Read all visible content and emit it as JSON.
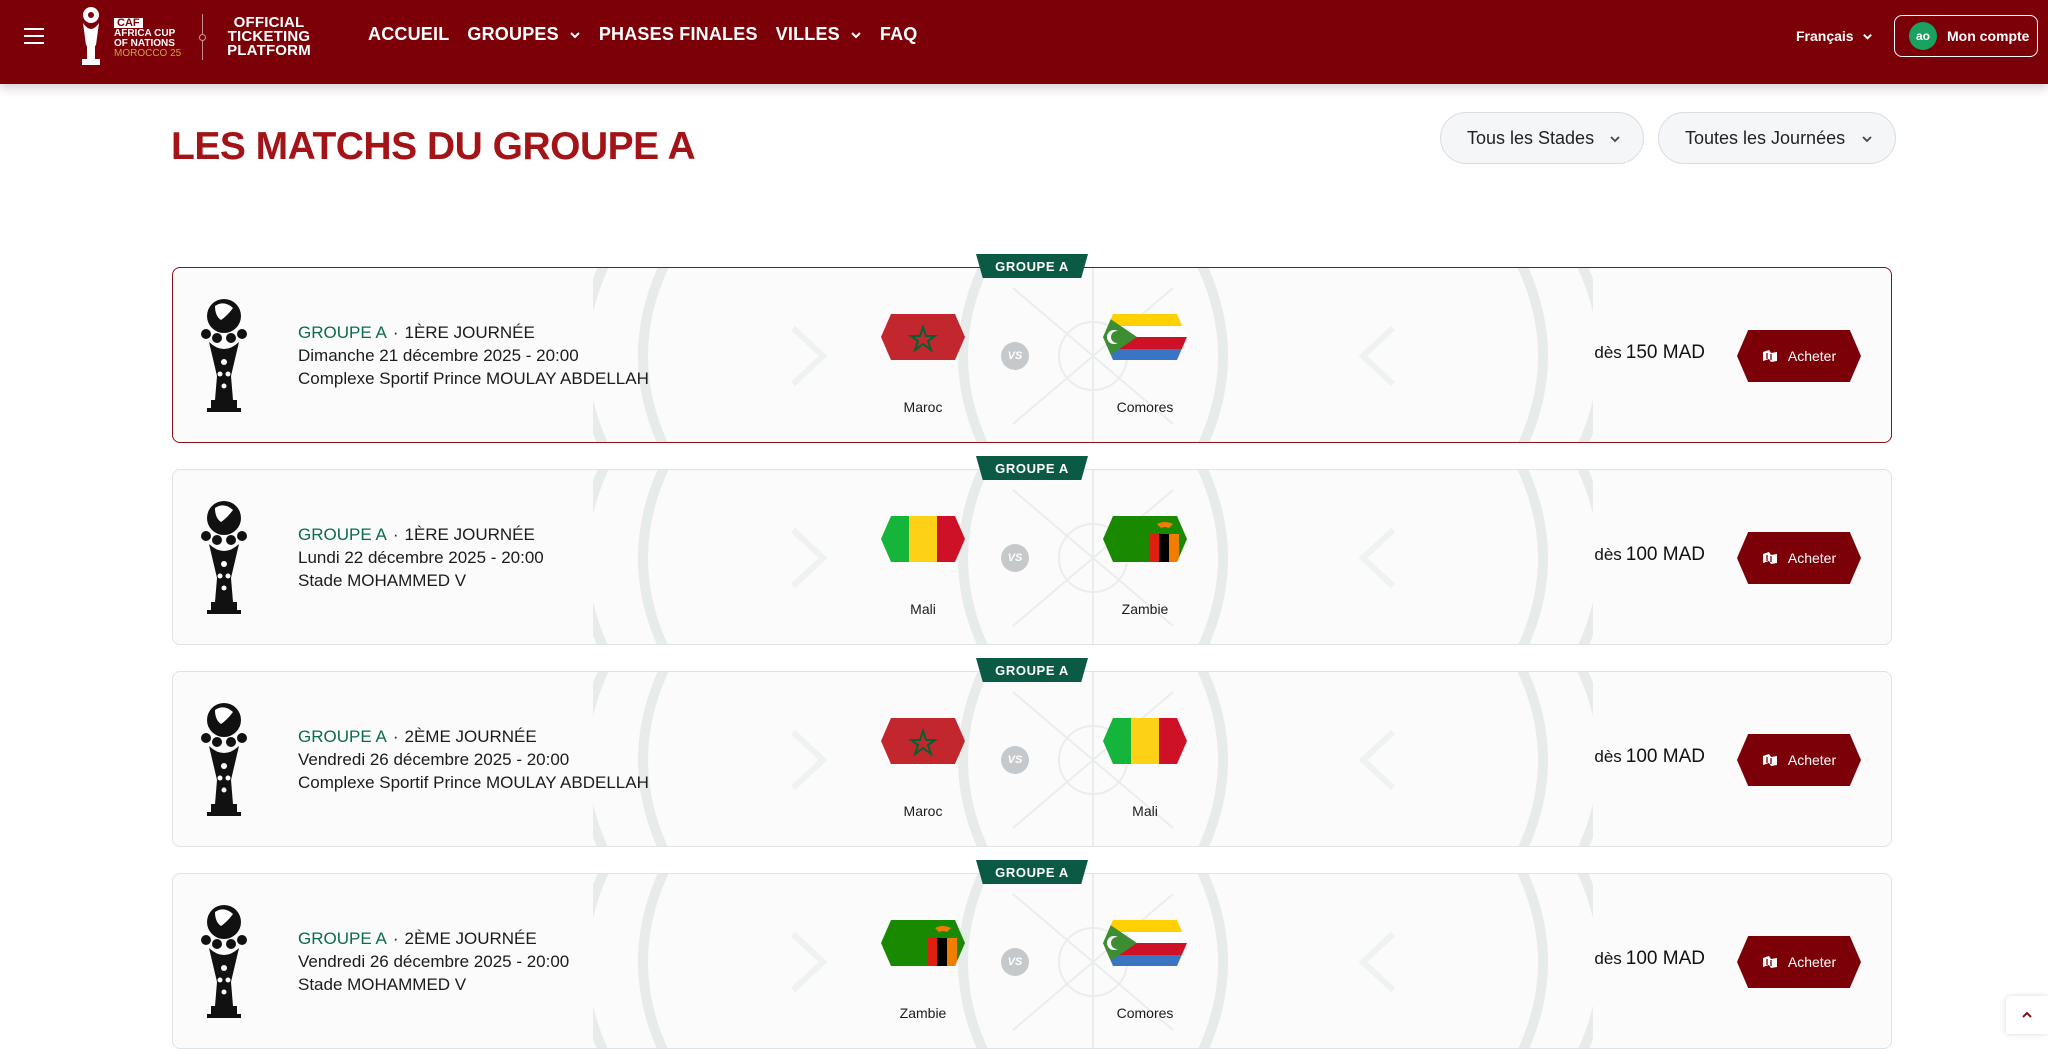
{
  "header": {
    "logo": {
      "caf": "CAF",
      "line1": "AFRICA CUP",
      "line2": "OF NATIONS",
      "line3": "MOROCCO 25"
    },
    "platform": {
      "line1": "OFFICIAL",
      "line2": "TICKETING",
      "line3": "PLATFORM"
    },
    "nav": [
      {
        "label": "ACCUEIL",
        "dropdown": false
      },
      {
        "label": "GROUPES",
        "dropdown": true
      },
      {
        "label": "PHASES FINALES",
        "dropdown": false
      },
      {
        "label": "VILLES",
        "dropdown": true
      },
      {
        "label": "FAQ",
        "dropdown": false
      }
    ],
    "language": "Français",
    "account": {
      "initials": "ao",
      "label": "Mon compte"
    }
  },
  "page": {
    "title": "LES MATCHS DU GROUPE A",
    "filters": {
      "stadiums": "Tous les Stades",
      "matchdays": "Toutes les Journées"
    }
  },
  "matches": [
    {
      "tag": "GROUPE A",
      "group": "GROUPE A",
      "matchday": "1ÈRE JOURNÉE",
      "datetime": "Dimanche 21 décembre 2025 - 20:00",
      "stadium": "Complexe Sportif Prince MOULAY ABDELLAH",
      "home": "Maroc",
      "away": "Comores",
      "home_flag": "morocco",
      "away_flag": "comoros",
      "vs": "VS",
      "price_prefix": "dès",
      "price": "150 MAD",
      "buy_label": "Acheter",
      "highlighted": true
    },
    {
      "tag": "GROUPE A",
      "group": "GROUPE A",
      "matchday": "1ÈRE JOURNÉE",
      "datetime": "Lundi 22 décembre 2025 - 20:00",
      "stadium": "Stade MOHAMMED V",
      "home": "Mali",
      "away": "Zambie",
      "home_flag": "mali",
      "away_flag": "zambia",
      "vs": "VS",
      "price_prefix": "dès",
      "price": "100 MAD",
      "buy_label": "Acheter",
      "highlighted": false
    },
    {
      "tag": "GROUPE A",
      "group": "GROUPE A",
      "matchday": "2ÈME JOURNÉE",
      "datetime": "Vendredi 26 décembre 2025 - 20:00",
      "stadium": "Complexe Sportif Prince MOULAY ABDELLAH",
      "home": "Maroc",
      "away": "Mali",
      "home_flag": "morocco",
      "away_flag": "mali",
      "vs": "VS",
      "price_prefix": "dès",
      "price": "100 MAD",
      "buy_label": "Acheter",
      "highlighted": false
    },
    {
      "tag": "GROUPE A",
      "group": "GROUPE A",
      "matchday": "2ÈME JOURNÉE",
      "datetime": "Vendredi 26 décembre 2025 - 20:00",
      "stadium": "Stade MOHAMMED V",
      "home": "Zambie",
      "away": "Comores",
      "home_flag": "zambia",
      "away_flag": "comoros",
      "vs": "VS",
      "price_prefix": "dès",
      "price": "100 MAD",
      "buy_label": "Acheter",
      "highlighted": false
    }
  ],
  "colors": {
    "brand_red": "#7c0008",
    "title_red": "#a31418",
    "group_green": "#0b5a45",
    "avatar_green": "#1aa260"
  },
  "icons": {
    "menu": "hamburger-icon",
    "chevron": "chevron-down-icon",
    "ticket": "ticket-icon",
    "scroll_top": "chevron-up-icon",
    "trophy": "trophy-icon"
  }
}
